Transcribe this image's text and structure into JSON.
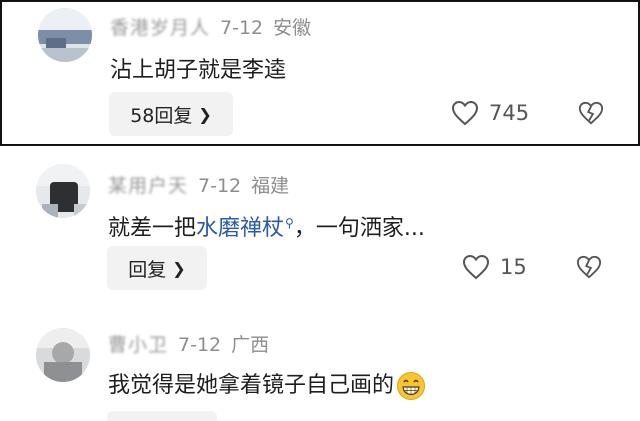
{
  "comments": [
    {
      "username": "香港岁月人",
      "date": "7-12",
      "region": "安徽",
      "text": "沾上胡子就是李逵",
      "reply_label": "58回复",
      "likes": "745"
    },
    {
      "username": "某用户天",
      "date": "7-12",
      "region": "福建",
      "text_before": "就差一把",
      "link_text": "水磨禅杖",
      "text_after": "，一句洒家...",
      "reply_label": "回复",
      "likes": "15"
    },
    {
      "username": "曹小卫",
      "date": "7-12",
      "region": "广西",
      "text": "我觉得是她拿着镜子自己画的",
      "emoji": "grinning-face-emoji"
    }
  ],
  "icons": {
    "like": "heart-outline-icon",
    "dislike": "broken-heart-icon",
    "reply_chevron": "chevron-right-icon",
    "search": "search-icon"
  },
  "colors": {
    "link": "#2b5aa8",
    "meta_text": "#8e8e8e",
    "reply_bg": "#f2f2f2",
    "highlight_border": "#111111"
  }
}
